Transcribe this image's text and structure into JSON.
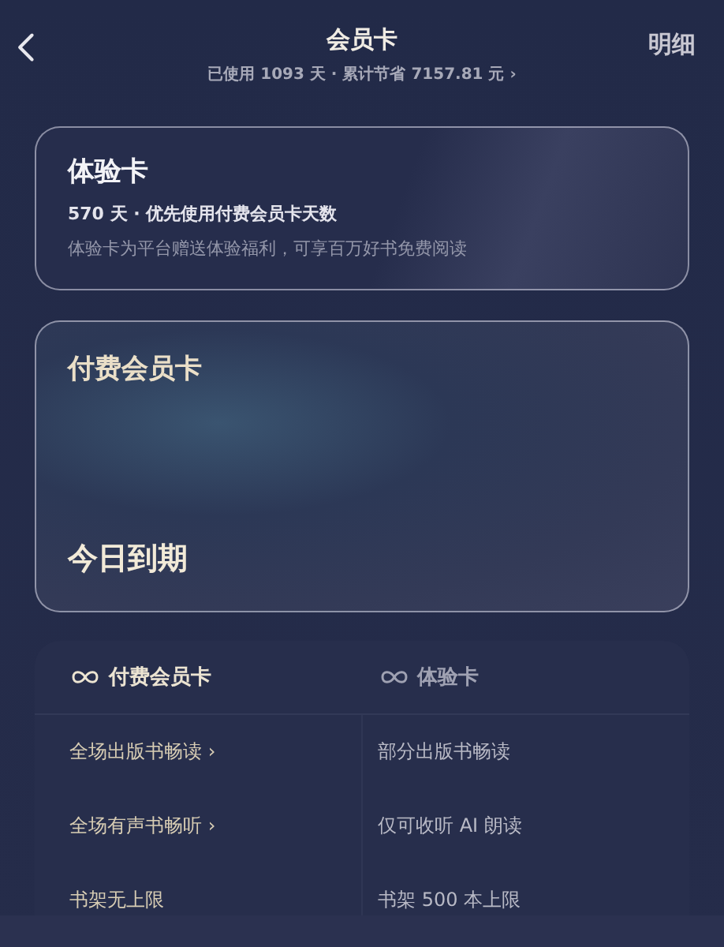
{
  "header": {
    "title": "会员卡",
    "subtitle": "已使用 1093 天 · 累计节省 7157.81 元 ›",
    "action": "明细"
  },
  "cards": [
    {
      "kind": "trial",
      "title": "体验卡",
      "line1": "570 天 · 优先使用付费会员卡天数",
      "line2": "体验卡为平台赠送体验福利，可享百万好书免费阅读"
    },
    {
      "kind": "paid",
      "title": "付费会员卡",
      "status": "今日到期"
    }
  ],
  "comparison": {
    "columns": [
      {
        "label": "付费会员卡",
        "kind": "paid"
      },
      {
        "label": "体验卡",
        "kind": "trial"
      }
    ],
    "rows": [
      [
        "全场出版书畅读 ›",
        "部分出版书畅读"
      ],
      [
        "全场有声书畅听 ›",
        "仅可收听 AI 朗读"
      ],
      [
        "书架无上限",
        "书架 500 本上限"
      ]
    ]
  }
}
